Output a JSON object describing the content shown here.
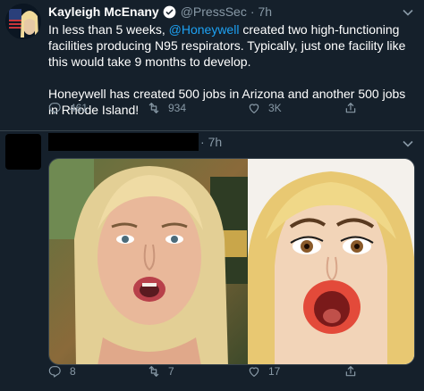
{
  "tweet1": {
    "author_name": "Kayleigh McEnany",
    "handle": "@PressSec",
    "separator": "·",
    "time": "7h",
    "text_before_mention": "In less than 5 weeks, ",
    "mention": "@Honeywell",
    "text_after_mention": " created two high-functioning facilities producing N95 respirators. Typically, just one facility like this would take 9 months to develop.",
    "text_para2": "Honeywell has created 500 jobs in Arizona and another 500 jobs in Rhode Island!",
    "replies": "461",
    "retweets": "934",
    "likes": "3K"
  },
  "tweet2": {
    "separator": "·",
    "time": "7h",
    "replies": "8",
    "retweets": "7",
    "likes": "17"
  },
  "colors": {
    "background": "#15202b",
    "accent": "#1da1f2",
    "secondary_text": "#8899a6",
    "divider": "#38444d"
  },
  "icons": [
    "verified-badge-icon",
    "chevron-down-icon",
    "reply-icon",
    "retweet-icon",
    "like-icon",
    "share-icon"
  ]
}
